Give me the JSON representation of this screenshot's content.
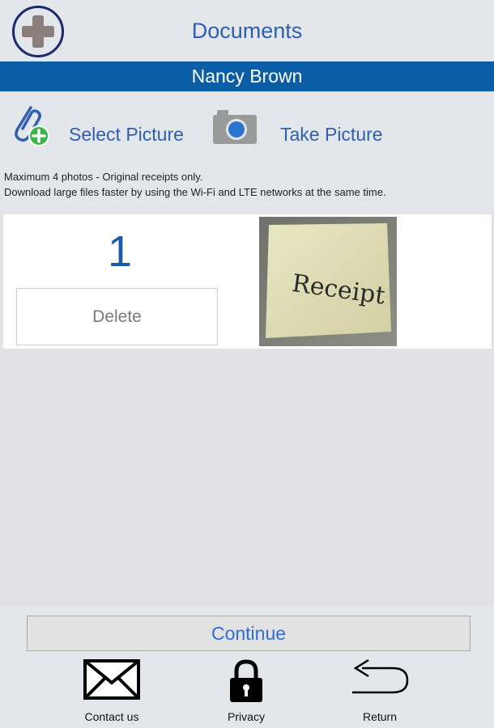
{
  "header": {
    "title": "Documents"
  },
  "user": {
    "name": "Nancy Brown"
  },
  "actions": {
    "select_picture": "Select Picture",
    "take_picture": "Take Picture"
  },
  "notes": {
    "line1": "Maximum 4 photos - Original receipts only.",
    "line2": "Download large files faster by using the Wi-Fi and LTE networks at the same time."
  },
  "photos": [
    {
      "number": "1",
      "delete_label": "Delete",
      "image_text": "Receipt"
    }
  ],
  "footer": {
    "continue_label": "Continue",
    "nav": [
      {
        "label": "Contact us",
        "icon": "envelope-icon"
      },
      {
        "label": "Privacy",
        "icon": "lock-icon"
      },
      {
        "label": "Return",
        "icon": "return-arrow-icon"
      }
    ]
  },
  "colors": {
    "accent": "#2f5fae",
    "bar": "#0b5ea6",
    "background": "#e3e7ec"
  }
}
